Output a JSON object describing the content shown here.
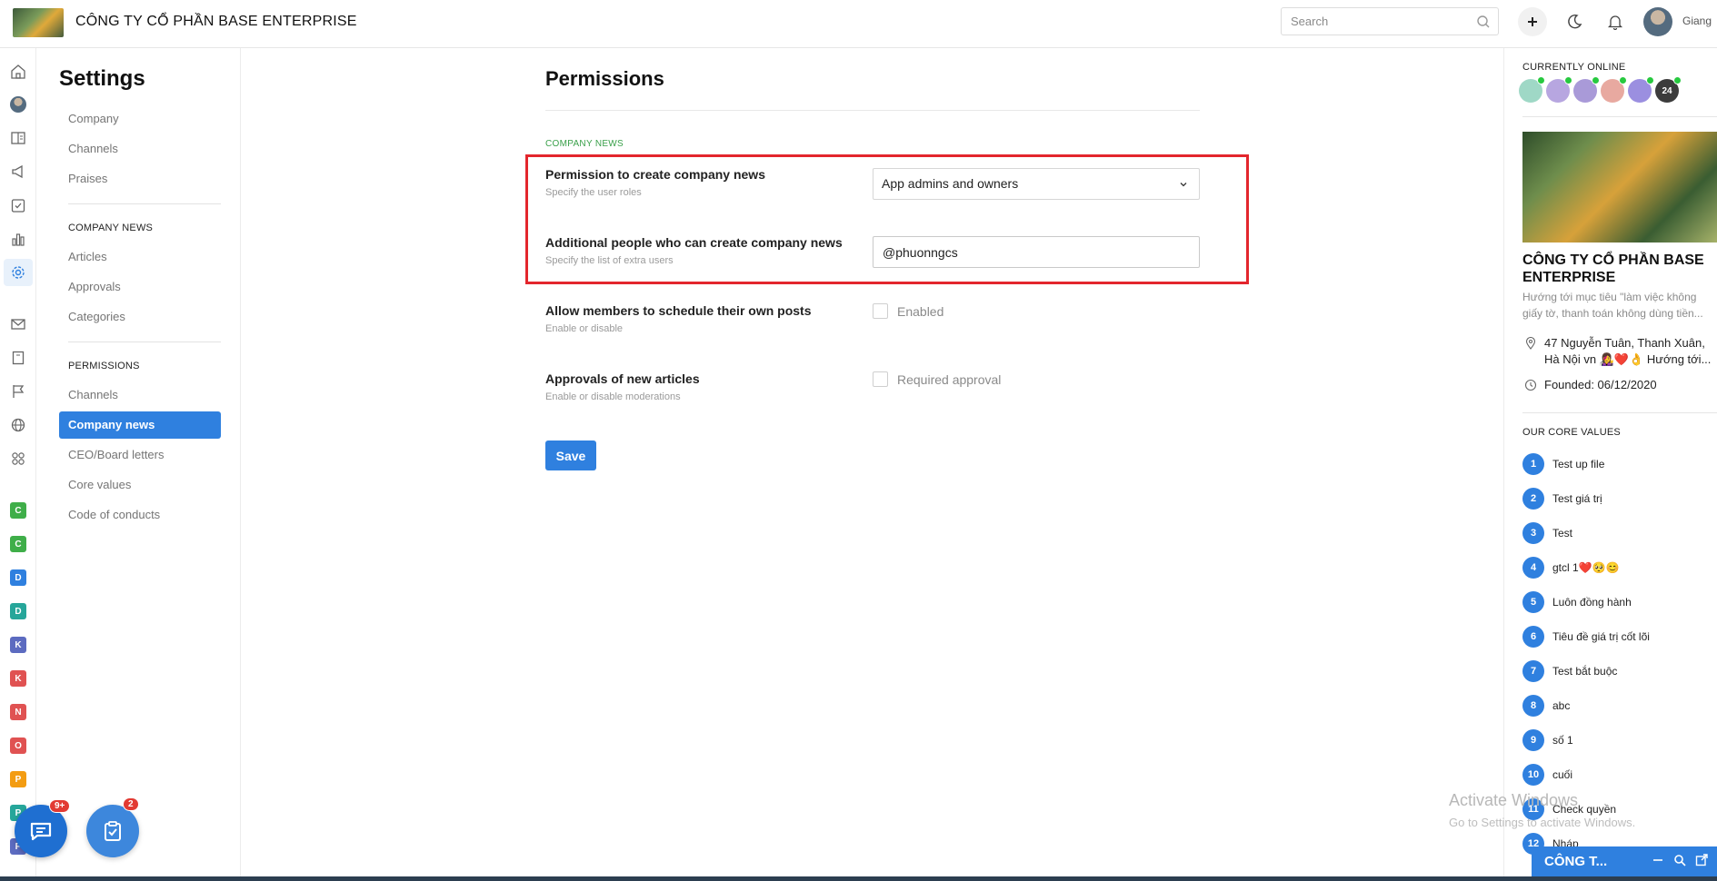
{
  "header": {
    "company_title": "CÔNG TY CỔ PHẦN BASE ENTERPRISE",
    "search_placeholder": "Search",
    "user_name": "Giang"
  },
  "rail": {
    "letters": [
      {
        "letter": "C",
        "color": "#3fae49"
      },
      {
        "letter": "C",
        "color": "#3fae49"
      },
      {
        "letter": "D",
        "color": "#2f80df"
      },
      {
        "letter": "D",
        "color": "#26a69a"
      },
      {
        "letter": "K",
        "color": "#5c6bc0"
      },
      {
        "letter": "K",
        "color": "#e05252"
      },
      {
        "letter": "N",
        "color": "#e05252"
      },
      {
        "letter": "O",
        "color": "#e05252"
      },
      {
        "letter": "P",
        "color": "#f39c12"
      },
      {
        "letter": "P",
        "color": "#26a69a"
      },
      {
        "letter": "P",
        "color": "#5c6bc0"
      }
    ]
  },
  "settings": {
    "title": "Settings",
    "top_links": [
      "Company",
      "Channels",
      "Praises"
    ],
    "company_news_heading": "COMPANY NEWS",
    "company_news_links": [
      "Articles",
      "Approvals",
      "Categories"
    ],
    "permissions_heading": "PERMISSIONS",
    "permissions_links": [
      "Channels",
      "Company news",
      "CEO/Board letters",
      "Core values",
      "Code of conducts"
    ],
    "active_link": "Company news"
  },
  "main": {
    "title": "Permissions",
    "section_label": "COMPANY NEWS",
    "fields": {
      "create_news": {
        "label": "Permission to create company news",
        "help": "Specify the user roles",
        "value": "App admins and owners"
      },
      "additional_people": {
        "label": "Additional people who can create company news",
        "help": "Specify the list of extra users",
        "value": "@phuonngcs"
      },
      "schedule_posts": {
        "label": "Allow members to schedule their own posts",
        "help": "Enable or disable",
        "checkbox_label": "Enabled",
        "checked": false
      },
      "approvals": {
        "label": "Approvals of new articles",
        "help": "Enable or disable moderations",
        "checkbox_label": "Required approval",
        "checked": false
      }
    },
    "save_label": "Save"
  },
  "right_panel": {
    "online_heading": "CURRENTLY ONLINE",
    "online_count": "24",
    "company_name": "CÔNG TY CỔ PHẦN BASE ENTERPRISE",
    "description": "Hướng tới mục tiêu \"làm việc không giấy tờ, thanh toán không dùng tiền...",
    "address": "47 Nguyễn Tuân, Thanh Xuân, Hà Nội vn 👩‍🎤❤️👌 Hướng tới...",
    "founded": "Founded: 06/12/2020",
    "core_values_heading": "OUR CORE VALUES",
    "core_values": [
      {
        "num": "1",
        "text": "Test up file"
      },
      {
        "num": "2",
        "text": "Test giá trị"
      },
      {
        "num": "3",
        "text": "Test"
      },
      {
        "num": "4",
        "text": "gtcl 1❤️🥺😊"
      },
      {
        "num": "5",
        "text": "Luôn đồng hành"
      },
      {
        "num": "6",
        "text": "Tiêu đề giá trị cốt lõi"
      },
      {
        "num": "7",
        "text": "Test bắt buộc"
      },
      {
        "num": "8",
        "text": "abc"
      },
      {
        "num": "9",
        "text": "số 1"
      },
      {
        "num": "10",
        "text": "cuối"
      },
      {
        "num": "11",
        "text": "Check quyền"
      },
      {
        "num": "12",
        "text": "Nháp"
      }
    ]
  },
  "floating": {
    "chat_badge": "9+",
    "task_badge": "2"
  },
  "watermark": {
    "line1": "Activate Windows",
    "line2": "Go to Settings to activate Windows."
  },
  "chat_bar": {
    "title": "CÔNG T..."
  }
}
